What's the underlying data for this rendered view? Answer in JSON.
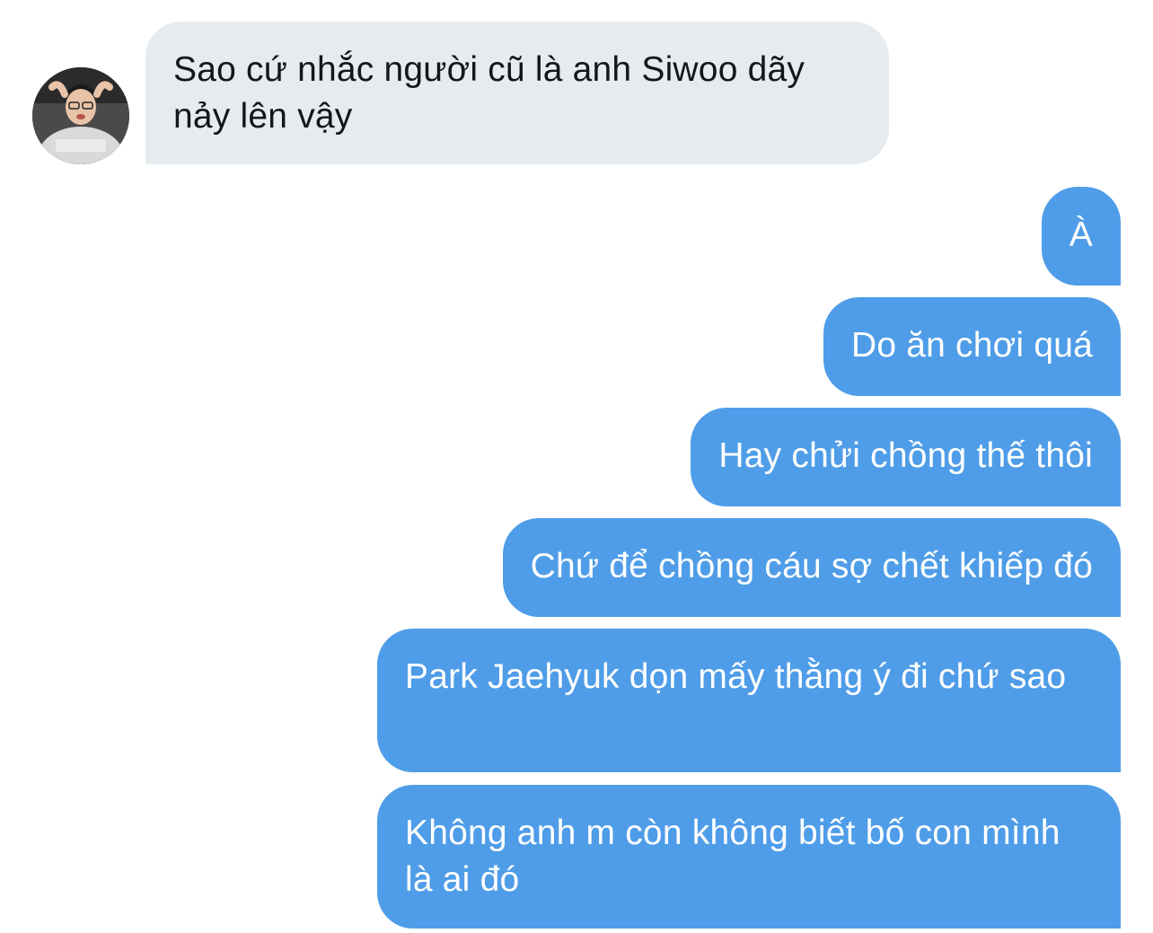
{
  "contact": {
    "avatar_icon": "profile-photo-avatar"
  },
  "messages": [
    {
      "direction": "incoming",
      "text": "Sao cứ nhắc người cũ là anh Siwoo dãy nảy lên vậy"
    },
    {
      "direction": "outgoing",
      "text": "À"
    },
    {
      "direction": "outgoing",
      "text": "Do ăn chơi quá"
    },
    {
      "direction": "outgoing",
      "text": "Hay chửi chồng thế thôi"
    },
    {
      "direction": "outgoing",
      "text": "Chứ để chồng cáu sợ chết khiếp đó"
    },
    {
      "direction": "outgoing",
      "text": "Park Jaehyuk dọn mấy thằng ý đi chứ sao"
    },
    {
      "direction": "outgoing",
      "text": "Không anh m còn không biết bố con mình là ai đó"
    }
  ],
  "colors": {
    "incoming_bubble": "#e6ebef",
    "incoming_text": "#14171a",
    "outgoing_bubble": "#4f9de8",
    "outgoing_text": "#ffffff"
  }
}
